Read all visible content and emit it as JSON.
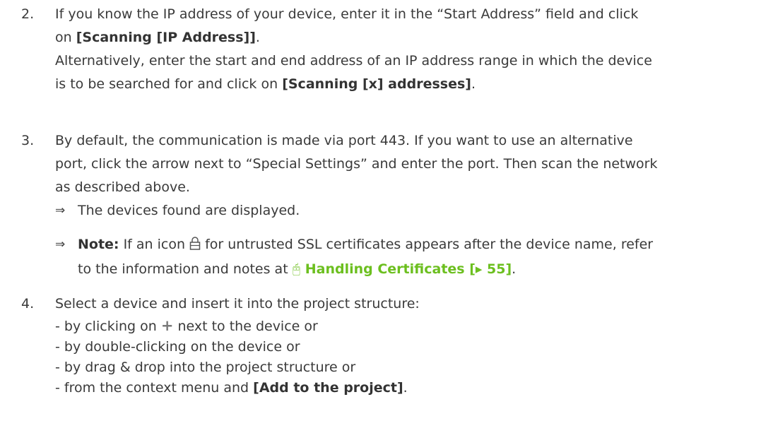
{
  "step2": {
    "number": "2.",
    "l1": "If you know the IP address of your device, enter it in the “Start Address” field and click",
    "l2_pre": "on ",
    "l2_bold": "[Scanning [IP Address]]",
    "l2_post": ".",
    "l3": "Alternatively, enter the start and end address of an IP address range in which the device",
    "l4_pre": "is to be searched for and click on ",
    "l4_bold": "[Scanning [x] addresses]",
    "l4_post": "."
  },
  "step3": {
    "number": "3.",
    "l1": "By default, the communication is made via port 443. If you want to use an alternative",
    "l2": "port, click the arrow next to “Special Settings” and enter the port. Then scan the network",
    "l3": "as described above.",
    "result1": "The devices found are displayed.",
    "result_arrow": "⇒",
    "note_label": "Note:",
    "note_text1_pre": " If an icon ",
    "note_text1_post": " for untrusted SSL certificates appears after the device name, refer",
    "note_text2_pre": "to the information and notes at ",
    "note_link_icon": "🖰",
    "note_link_text": "Handling Certificates [▸ 55]",
    "note_text2_post": "."
  },
  "step4": {
    "number": "4.",
    "l1": "Select a device and insert it into the project structure:",
    "l2_pre": "- by clicking on ",
    "plus_glyph": "+",
    "l2_post": " next to the device or",
    "l3": "- by double-clicking on the device or",
    "l4": "- by drag & drop into the project structure or",
    "l5_pre": "- from the context menu and ",
    "l5_bold": "[Add to the project]",
    "l5_post": "."
  }
}
